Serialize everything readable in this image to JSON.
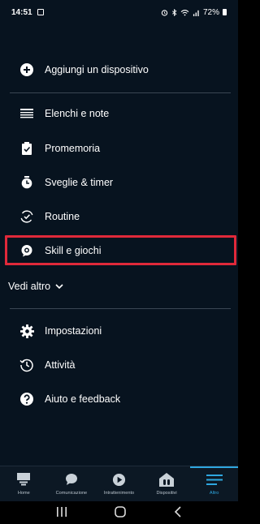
{
  "status_bar": {
    "time": "14:51",
    "battery": "72%"
  },
  "menu": {
    "add_device": "Aggiungi un dispositivo",
    "lists": "Elenchi e note",
    "reminders": "Promemoria",
    "alarms": "Sveglie & timer",
    "routines": "Routine",
    "skills": "Skill e giochi",
    "see_more": "Vedi altro",
    "settings": "Impostazioni",
    "activity": "Attività",
    "help": "Aiuto e feedback"
  },
  "tabs": [
    {
      "label": "Home",
      "icon": "home-icon"
    },
    {
      "label": "Comunicazione",
      "icon": "chat-bubble-icon"
    },
    {
      "label": "Intrattenimento",
      "icon": "play-icon"
    },
    {
      "label": "Dispositivi",
      "icon": "devices-icon"
    },
    {
      "label": "Altro",
      "icon": "more-lines-icon"
    }
  ],
  "colors": {
    "background": "#07131f",
    "highlight": "#e0293a",
    "accent": "#2ea7e0"
  }
}
